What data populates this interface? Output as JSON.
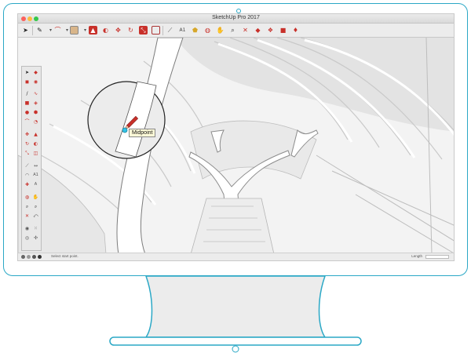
{
  "window": {
    "title": "SketchUp Pro 2017"
  },
  "toolbar": {
    "icons": [
      "select-icon",
      "line-icon",
      "arc-icon",
      "rectangle-icon",
      "push-pull-icon",
      "follow-me-icon",
      "move-icon",
      "rotate-icon",
      "scale-icon",
      "offset-icon",
      "tape-measure-icon",
      "text-icon",
      "paint-bucket-icon",
      "orbit-icon",
      "pan-icon",
      "zoom-icon",
      "zoom-extents-icon",
      "warehouse-icon",
      "extension-warehouse-icon",
      "layout-icon",
      "ruby-icon"
    ]
  },
  "viewport": {
    "inference_tooltip": "Midpoint"
  },
  "statusbar": {
    "hint": "Select start point.",
    "measurements_label": "Length"
  },
  "colors": {
    "monitor_outline": "#2ba8c6",
    "tooltip_bg": "#fffbd8",
    "accent_red": "#c8302a"
  }
}
